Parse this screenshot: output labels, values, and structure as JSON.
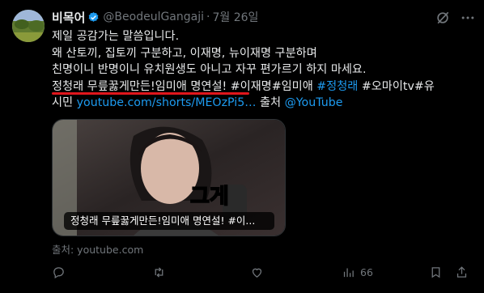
{
  "tweet": {
    "author_name": "비목어",
    "handle": "@BeodeulGangaji",
    "separator": "·",
    "date": "7월 26일",
    "text_lines": [
      "제일 공감가는 말씀입니다.",
      "왜 산토끼, 집토끼 구분하고, 이재명, 뉴이재명 구분하며",
      "친명이니 반명이니 유치원생도 아니고 자꾸 편가르기 하지 마세요."
    ],
    "line4_plain": "정청래 무릎꿇게만든!임미애 명연설! #이재명#임미애  ",
    "line4_hashtag": "#정청래",
    "line4_rest": " #오마이tv#유",
    "line5_start": "시민 ",
    "line5_link": "youtube.com/shorts/MEOzPi5…",
    "line5_mid": " 출처 ",
    "line5_mention": "@YouTube",
    "video_caption": "정청래 무릎꿇게만든!임미애 명연설! #이...",
    "video_overlay_text": "그게",
    "source_label": "출처: youtube.com"
  },
  "actions": {
    "reply_count": "",
    "retweet_count": "",
    "like_count": "",
    "view_count": "66"
  },
  "colors": {
    "background": "#000000",
    "text": "#e7e9ea",
    "secondary": "#71767b",
    "link": "#1d9bf0",
    "verified": "#1d9bf0",
    "underline": "#e0161c"
  }
}
